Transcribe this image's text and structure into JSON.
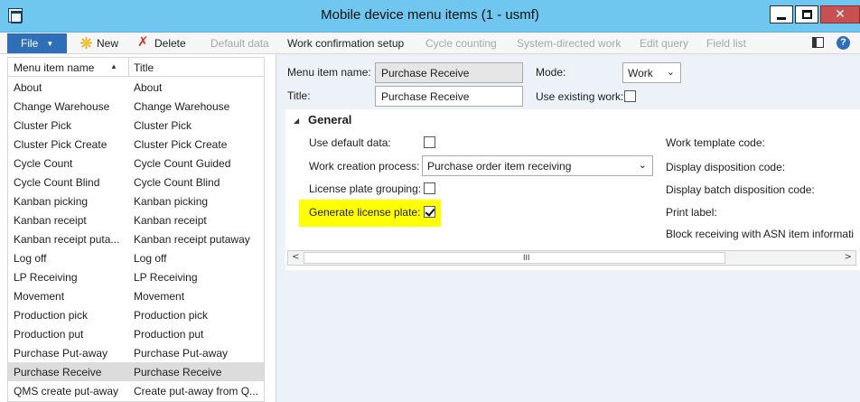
{
  "window": {
    "title": "Mobile device menu items (1 - usmf)",
    "close_glyph": "✕"
  },
  "toolbar": {
    "file_label": "File",
    "new_label": "New",
    "delete_label": "Delete",
    "default_data_label": "Default data",
    "work_confirmation_label": "Work confirmation setup",
    "cycle_counting_label": "Cycle counting",
    "system_directed_label": "System-directed work",
    "edit_query_label": "Edit query",
    "field_list_label": "Field list",
    "help_glyph": "?"
  },
  "grid": {
    "columns": [
      "Menu item name",
      "Title"
    ],
    "rows": [
      {
        "name": "About",
        "title": "About"
      },
      {
        "name": "Change Warehouse",
        "title": "Change Warehouse"
      },
      {
        "name": "Cluster Pick",
        "title": "Cluster Pick"
      },
      {
        "name": "Cluster Pick Create",
        "title": "Cluster Pick Create"
      },
      {
        "name": "Cycle Count",
        "title": "Cycle Count Guided"
      },
      {
        "name": "Cycle Count Blind",
        "title": "Cycle Count Blind"
      },
      {
        "name": "Kanban picking",
        "title": "Kanban picking"
      },
      {
        "name": "Kanban receipt",
        "title": "Kanban receipt"
      },
      {
        "name": "Kanban receipt puta...",
        "title": "Kanban receipt putaway"
      },
      {
        "name": "Log off",
        "title": "Log off"
      },
      {
        "name": "LP Receiving",
        "title": "LP Receiving"
      },
      {
        "name": "Movement",
        "title": "Movement"
      },
      {
        "name": "Production pick",
        "title": "Production pick"
      },
      {
        "name": "Production put",
        "title": "Production put"
      },
      {
        "name": "Purchase Put-away",
        "title": "Purchase Put-away"
      },
      {
        "name": "Purchase Receive",
        "title": "Purchase Receive"
      },
      {
        "name": "QMS create put-away",
        "title": "Create put-away from Q..."
      }
    ],
    "selected_index": 15
  },
  "header_form": {
    "menu_item_name_label": "Menu item name:",
    "menu_item_name_value": "Purchase Receive",
    "title_label": "Title:",
    "title_value": "Purchase Receive",
    "mode_label": "Mode:",
    "mode_value": "Work",
    "use_existing_work_label": "Use existing work:",
    "use_existing_work_checked": false
  },
  "general": {
    "title": "General",
    "use_default_data_label": "Use default data:",
    "use_default_data_checked": false,
    "work_creation_label": "Work creation process:",
    "work_creation_value": "Purchase order item receiving",
    "license_plate_grouping_label": "License plate grouping:",
    "license_plate_grouping_checked": false,
    "generate_license_plate_label": "Generate license plate:",
    "generate_license_plate_checked": true,
    "right_labels": [
      "Work template code:",
      "Display disposition code:",
      "Display batch disposition code:",
      "Print label:",
      "Block receiving with ASN item informati"
    ],
    "scroll_grip": "III"
  },
  "colors": {
    "titlebar": "#6fc6ee",
    "file_button": "#2f6fb9",
    "highlight": "#ffff00",
    "form_background": "#ecf2f7"
  }
}
